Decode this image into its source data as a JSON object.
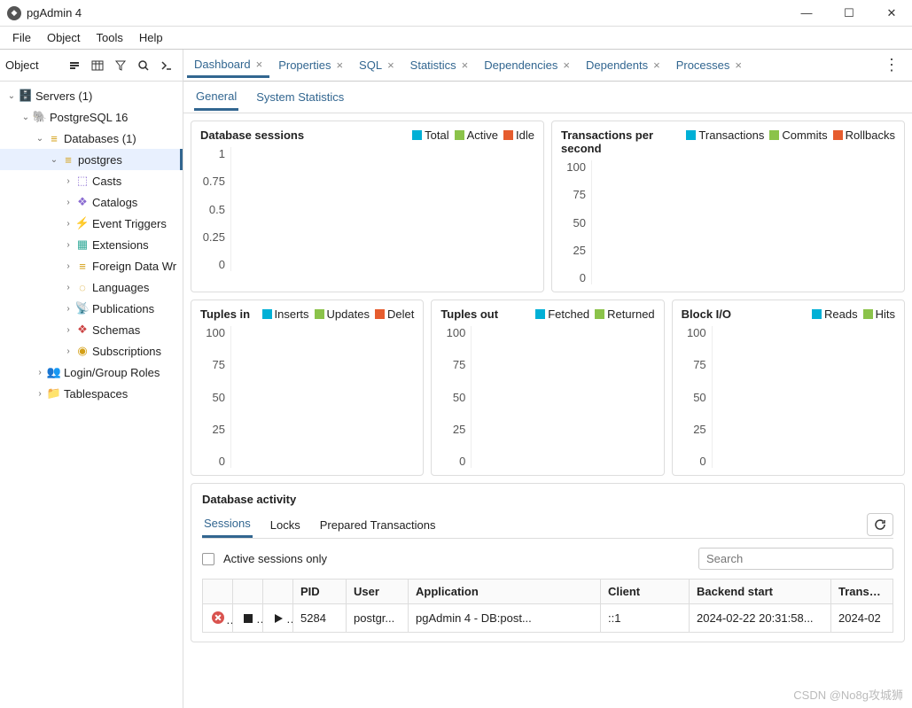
{
  "window": {
    "title": "pgAdmin 4"
  },
  "menubar": [
    "File",
    "Object",
    "Tools",
    "Help"
  ],
  "sidebar": {
    "header": "Object",
    "tree": {
      "servers": {
        "label": "Servers (1)"
      },
      "pg": {
        "label": "PostgreSQL 16"
      },
      "databases": {
        "label": "Databases (1)"
      },
      "postgres": {
        "label": "postgres"
      },
      "children": [
        {
          "label": "Casts",
          "icon": "casts"
        },
        {
          "label": "Catalogs",
          "icon": "catalogs"
        },
        {
          "label": "Event Triggers",
          "icon": "event-triggers"
        },
        {
          "label": "Extensions",
          "icon": "extensions"
        },
        {
          "label": "Foreign Data Wr",
          "icon": "fdw"
        },
        {
          "label": "Languages",
          "icon": "languages"
        },
        {
          "label": "Publications",
          "icon": "publications"
        },
        {
          "label": "Schemas",
          "icon": "schemas"
        },
        {
          "label": "Subscriptions",
          "icon": "subscriptions"
        }
      ],
      "login_roles": {
        "label": "Login/Group Roles"
      },
      "tablespaces": {
        "label": "Tablespaces"
      }
    }
  },
  "tabs": [
    "Dashboard",
    "Properties",
    "SQL",
    "Statistics",
    "Dependencies",
    "Dependents",
    "Processes"
  ],
  "subtabs": [
    "General",
    "System Statistics"
  ],
  "cards": {
    "sessions": {
      "title": "Database sessions",
      "legend": [
        {
          "label": "Total",
          "color": "#00b0d6"
        },
        {
          "label": "Active",
          "color": "#8bc34a"
        },
        {
          "label": "Idle",
          "color": "#e65c2e"
        }
      ],
      "yticks": [
        "1",
        "0.75",
        "0.5",
        "0.25",
        "0"
      ]
    },
    "tps": {
      "title": "Transactions per second",
      "legend": [
        {
          "label": "Transactions",
          "color": "#00b0d6"
        },
        {
          "label": "Commits",
          "color": "#8bc34a"
        },
        {
          "label": "Rollbacks",
          "color": "#e65c2e"
        }
      ],
      "yticks": [
        "100",
        "75",
        "50",
        "25",
        "0"
      ]
    },
    "tuples_in": {
      "title": "Tuples in",
      "legend": [
        {
          "label": "Inserts",
          "color": "#00b0d6"
        },
        {
          "label": "Updates",
          "color": "#8bc34a"
        },
        {
          "label": "Delet",
          "color": "#e65c2e"
        }
      ],
      "yticks": [
        "100",
        "75",
        "50",
        "25",
        "0"
      ]
    },
    "tuples_out": {
      "title": "Tuples out",
      "legend": [
        {
          "label": "Fetched",
          "color": "#00b0d6"
        },
        {
          "label": "Returned",
          "color": "#8bc34a"
        }
      ],
      "yticks": [
        "100",
        "75",
        "50",
        "25",
        "0"
      ]
    },
    "block_io": {
      "title": "Block I/O",
      "legend": [
        {
          "label": "Reads",
          "color": "#00b0d6"
        },
        {
          "label": "Hits",
          "color": "#8bc34a"
        }
      ],
      "yticks": [
        "100",
        "75",
        "50",
        "25",
        "0"
      ]
    }
  },
  "activity": {
    "title": "Database activity",
    "tabs": [
      "Sessions",
      "Locks",
      "Prepared Transactions"
    ],
    "active_only": "Active sessions only",
    "search_placeholder": "Search",
    "columns": [
      "",
      "",
      "",
      "PID",
      "User",
      "Application",
      "Client",
      "Backend start",
      "Transact"
    ],
    "rows": [
      {
        "pid": "5284",
        "user": "postgr...",
        "app": "pgAdmin 4 - DB:post...",
        "client": "::1",
        "start": "2024-02-22 20:31:58...",
        "txn": "2024-02"
      }
    ]
  },
  "watermark": "CSDN @No8g攻城狮",
  "chart_data": [
    {
      "type": "line",
      "title": "Database sessions",
      "series": [
        {
          "name": "Total",
          "values": []
        },
        {
          "name": "Active",
          "values": []
        },
        {
          "name": "Idle",
          "values": []
        }
      ],
      "ylim": [
        0,
        1
      ],
      "yticks": [
        0,
        0.25,
        0.5,
        0.75,
        1
      ]
    },
    {
      "type": "line",
      "title": "Transactions per second",
      "series": [
        {
          "name": "Transactions",
          "values": []
        },
        {
          "name": "Commits",
          "values": []
        },
        {
          "name": "Rollbacks",
          "values": []
        }
      ],
      "ylim": [
        0,
        100
      ],
      "yticks": [
        0,
        25,
        50,
        75,
        100
      ]
    },
    {
      "type": "line",
      "title": "Tuples in",
      "series": [
        {
          "name": "Inserts",
          "values": []
        },
        {
          "name": "Updates",
          "values": []
        },
        {
          "name": "Deletes",
          "values": []
        }
      ],
      "ylim": [
        0,
        100
      ],
      "yticks": [
        0,
        25,
        50,
        75,
        100
      ]
    },
    {
      "type": "line",
      "title": "Tuples out",
      "series": [
        {
          "name": "Fetched",
          "values": []
        },
        {
          "name": "Returned",
          "values": []
        }
      ],
      "ylim": [
        0,
        100
      ],
      "yticks": [
        0,
        25,
        50,
        75,
        100
      ]
    },
    {
      "type": "line",
      "title": "Block I/O",
      "series": [
        {
          "name": "Reads",
          "values": []
        },
        {
          "name": "Hits",
          "values": []
        }
      ],
      "ylim": [
        0,
        100
      ],
      "yticks": [
        0,
        25,
        50,
        75,
        100
      ]
    }
  ]
}
